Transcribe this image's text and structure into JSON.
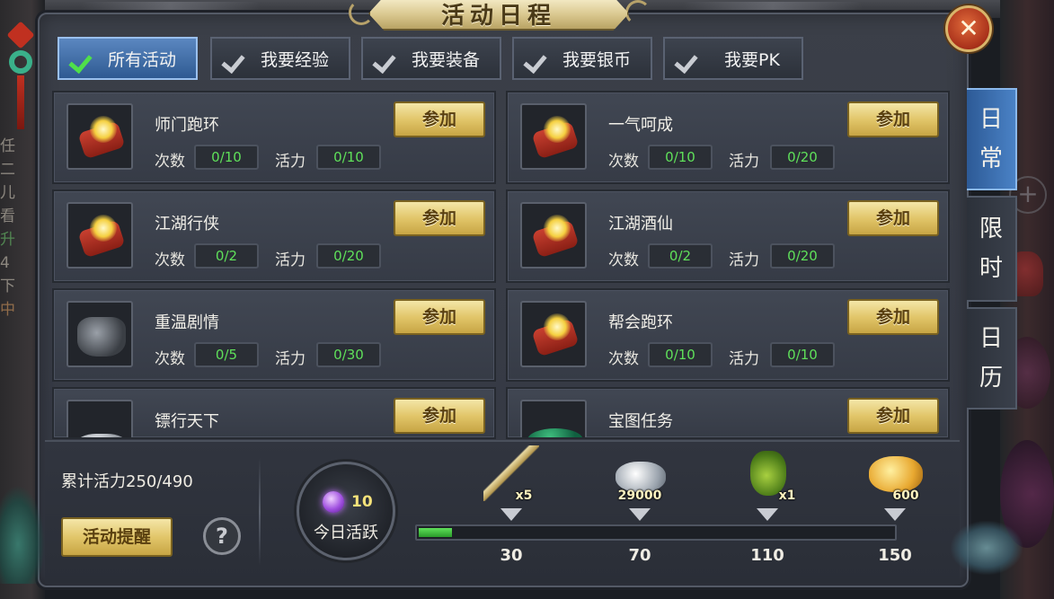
{
  "title": "活动日程",
  "filters": [
    {
      "label": "所有活动",
      "active": true
    },
    {
      "label": "我要经验",
      "active": false
    },
    {
      "label": "我要装备",
      "active": false
    },
    {
      "label": "我要银币",
      "active": false
    },
    {
      "label": "我要PK",
      "active": false
    }
  ],
  "stat_labels": {
    "count": "次数",
    "vigor": "活力"
  },
  "join_label": "参加",
  "activities": [
    {
      "name": "师门跑环",
      "icon": "scroll-icon",
      "count": "0/10",
      "vigor": "0/10"
    },
    {
      "name": "一气呵成",
      "icon": "scroll-icon",
      "count": "0/10",
      "vigor": "0/20"
    },
    {
      "name": "江湖行侠",
      "icon": "scroll-icon",
      "count": "0/2",
      "vigor": "0/20"
    },
    {
      "name": "江湖酒仙",
      "icon": "scroll-icon",
      "count": "0/2",
      "vigor": "0/20"
    },
    {
      "name": "重温剧情",
      "icon": "armor-icon",
      "count": "0/5",
      "vigor": "0/30"
    },
    {
      "name": "帮会跑环",
      "icon": "scroll-icon",
      "count": "0/10",
      "vigor": "0/10"
    },
    {
      "name": "镖行天下",
      "icon": "silver-icon"
    },
    {
      "name": "宝图任务",
      "icon": "treasure-map-icon"
    }
  ],
  "side_tabs": [
    {
      "label": "日常",
      "chars": [
        "日",
        "常"
      ],
      "active": true
    },
    {
      "label": "限时",
      "chars": [
        "限",
        "时"
      ],
      "active": false
    },
    {
      "label": "日历",
      "chars": [
        "日",
        "历"
      ],
      "active": false
    }
  ],
  "bottom": {
    "accumulated": "累计活力250/490",
    "remind_label": "活动提醒",
    "help_label": "?",
    "today_value": "10",
    "today_label": "今日活跃",
    "progress_fraction": 0.07,
    "milestones": [
      {
        "value": "30",
        "reward": "sword-icon",
        "count": "x5"
      },
      {
        "value": "70",
        "reward": "silver-pile-icon",
        "count": "29000"
      },
      {
        "value": "110",
        "reward": "money-bag-icon",
        "count": "x1"
      },
      {
        "value": "150",
        "reward": "gold-coins-icon",
        "count": "600"
      }
    ]
  },
  "background_left_text": [
    "任",
    "二",
    "儿",
    "看",
    "升",
    "4",
    "下",
    "中"
  ],
  "colors": {
    "accent_green": "#5fe05a",
    "active_blue": "#4a82c6",
    "button_gold": "#e2c66a",
    "close_red": "#a8301a"
  }
}
